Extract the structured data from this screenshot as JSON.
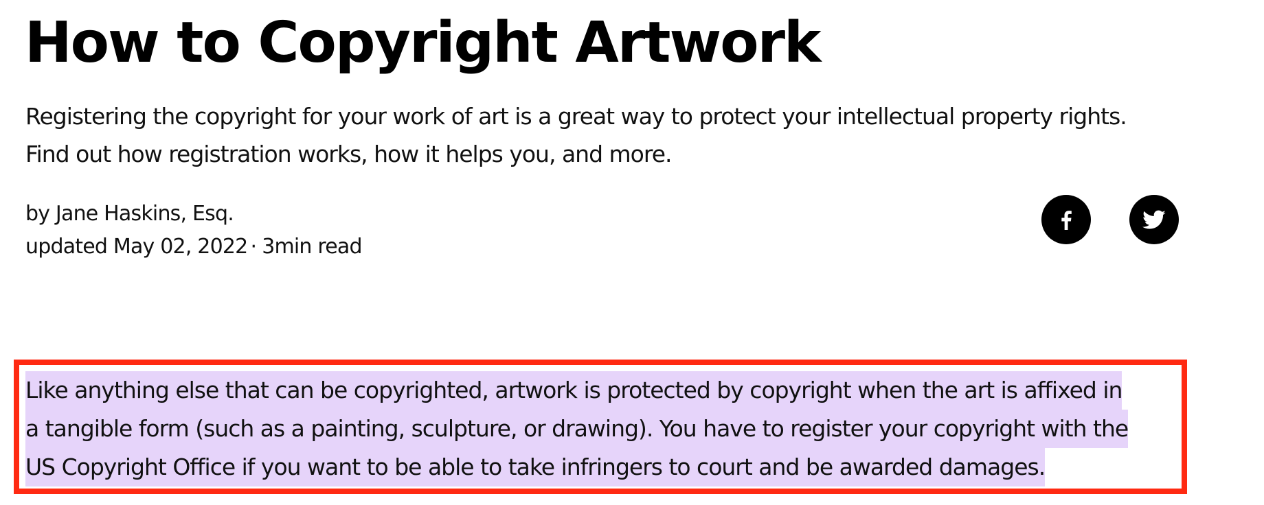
{
  "article": {
    "title": "How to Copyright Artwork",
    "subtitle_lines": [
      "Registering the copyright for your work of art is a great way to protect your intellectual property rights.",
      "Find out how registration works, how it helps you, and more."
    ],
    "author": "by Jane Haskins, Esq.",
    "updated": "updated May 02, 2022",
    "separator": "·",
    "read_time": "3min read"
  },
  "social": {
    "facebook_icon": "facebook-icon",
    "twitter_icon": "twitter-icon"
  },
  "highlighted_passage": {
    "lines": [
      "Like anything else that can be copyrighted, artwork is protected by copyright when the art is affixed in",
      "a tangible form (such as a painting, sculpture, or drawing). You have to register your copyright with the",
      "US Copyright Office if you want to be able to take infringers to court and be awarded damages."
    ],
    "highlight_color": "#e6d4fa",
    "box_color": "#ff2a12"
  }
}
